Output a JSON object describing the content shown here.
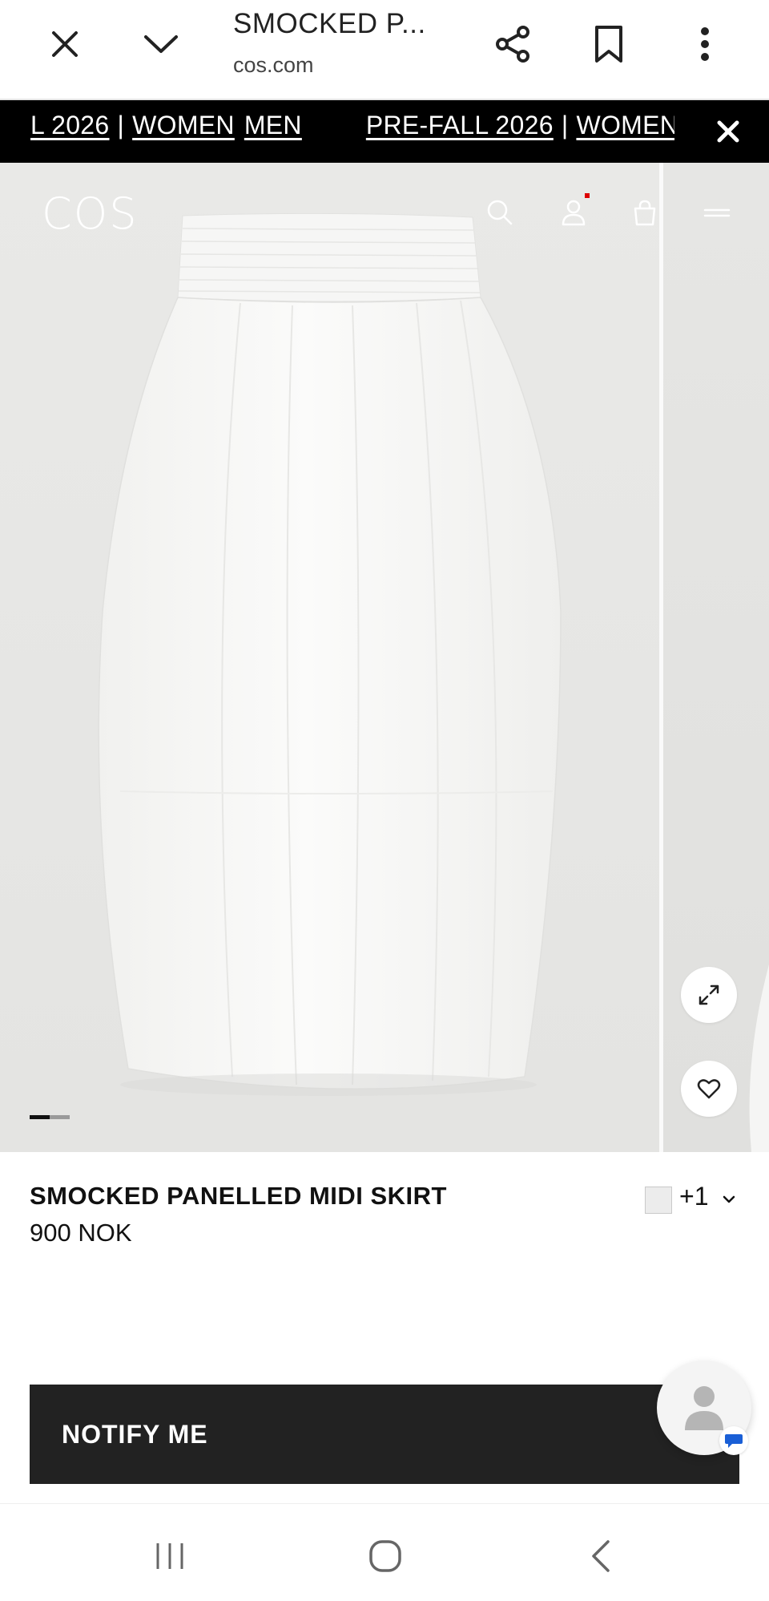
{
  "browser": {
    "title": "SMOCKED P...",
    "url": "cos.com",
    "icons": [
      "close-icon",
      "chevron-down-icon",
      "share-icon",
      "bookmark-icon",
      "more-vertical-icon"
    ]
  },
  "promo": {
    "items": [
      {
        "text": "L 2026",
        "link": true
      },
      {
        "text": "|",
        "link": false
      },
      {
        "text": "WOMEN",
        "link": true
      },
      {
        "text": "MEN",
        "link": true
      },
      {
        "text": "PRE-FALL 2026",
        "link": true
      },
      {
        "text": "|",
        "link": false
      },
      {
        "text": "WOMEN",
        "link": true
      }
    ],
    "close_icon": "close-icon",
    "background": "#000000"
  },
  "site_header": {
    "logo": "COS",
    "icons": [
      "search-icon",
      "account-icon",
      "bag-icon",
      "menu-icon"
    ],
    "notification_color": "#d00000"
  },
  "gallery": {
    "image_alt": "White smocked panelled midi skirt",
    "slide_index": 1,
    "slide_count": 2,
    "actions": [
      "expand-icon",
      "heart-icon"
    ]
  },
  "product": {
    "name": "SMOCKED PANELLED MIDI SKIRT",
    "price": "900 NOK",
    "more_colors": "+1",
    "swatch_color": "#ececec"
  },
  "cta": {
    "label": "NOTIFY ME",
    "background": "#222222"
  },
  "chat": {
    "icon": "person-icon",
    "badge_icon": "chat-bubble-icon",
    "badge_color": "#1a5fd6"
  },
  "system_nav": {
    "buttons": [
      "recents-icon",
      "home-icon",
      "back-icon"
    ]
  }
}
